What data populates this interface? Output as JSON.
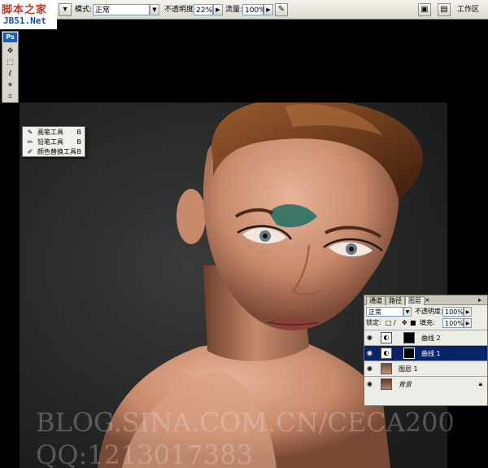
{
  "logo": {
    "line1": "脚本之家",
    "line2": "JB51.Net"
  },
  "options_bar": {
    "mode_label": "模式:",
    "mode_value": "正常",
    "opacity_label": "不透明度:",
    "opacity_value": "22%",
    "flow_label": "流量:",
    "flow_value": "100%",
    "workspace_label": "工作区"
  },
  "toolbox": {
    "badge": "Ps"
  },
  "flyout": {
    "items": [
      {
        "label": "画笔工具",
        "key": "B"
      },
      {
        "label": "铅笔工具",
        "key": "B"
      },
      {
        "label": "颜色替换工具",
        "key": "B"
      }
    ]
  },
  "watermark": {
    "line1": "BLOG.SINA.COM.CN/CECA200",
    "line2": "QQ:1213017383"
  },
  "layers_panel": {
    "tabs": [
      "通道",
      "路径",
      "图层"
    ],
    "blend_mode": "正常",
    "opacity_label": "不透明度:",
    "opacity_value": "100%",
    "lock_label": "锁定:",
    "fill_label": "填充:",
    "fill_value": "100%",
    "layers": [
      {
        "name": "曲线 2",
        "selected": false
      },
      {
        "name": "曲线 1",
        "selected": true
      },
      {
        "name": "图层 1",
        "selected": false
      },
      {
        "name": "背景",
        "selected": false
      }
    ]
  },
  "colors": {
    "selection": "#0a246a",
    "canvas_bg": "#282828",
    "eyeshadow": "#1f6e63"
  }
}
